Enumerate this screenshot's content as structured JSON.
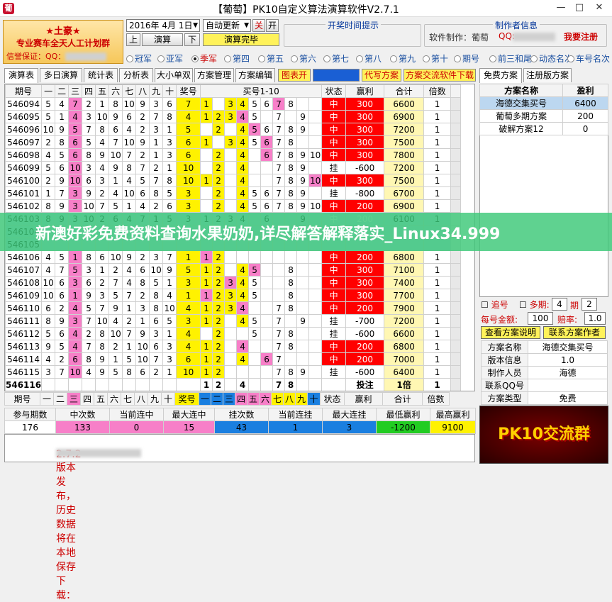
{
  "window": {
    "title": "【葡萄】PK10自定义算法演算软件V2.7.1",
    "icon": "葡"
  },
  "promo": {
    "line1": "★土豪★",
    "line2": "专业赛车全天人工计划群",
    "line3": "信誉保证：QQ："
  },
  "toolbar": {
    "date": "2016年 4月 1日",
    "auto_update": "自动更新",
    "off": "关",
    "on": "开",
    "up": "上",
    "calc": "演算",
    "down": "下",
    "calc_done": "演算完毕",
    "open_time_hint": "开奖时间提示",
    "author_info": "制作者信息",
    "software_by": "软件制作：葡萄",
    "qq_label": "QQ:",
    "register": "我要注册"
  },
  "radios": [
    {
      "label": "冠军",
      "on": false
    },
    {
      "label": "亚军",
      "on": false
    },
    {
      "label": "季军",
      "on": true
    },
    {
      "label": "第四",
      "on": false
    },
    {
      "label": "第五",
      "on": false
    },
    {
      "label": "第六",
      "on": false
    },
    {
      "label": "第七",
      "on": false
    },
    {
      "label": "第八",
      "on": false
    },
    {
      "label": "第九",
      "on": false
    },
    {
      "label": "第十",
      "on": false
    },
    {
      "label": "期号",
      "on": false
    },
    {
      "label": "前三和尾",
      "on": false
    },
    {
      "label": "动态名次",
      "on": false
    },
    {
      "label": "车号名次",
      "on": false
    }
  ],
  "tabs": [
    "演算表",
    "多日演算",
    "统计表",
    "分析表",
    "大小单双",
    "方案管理",
    "方案编辑"
  ],
  "toolbar2": {
    "chart": "图表开",
    "proxy": "代写方案",
    "download": "方案交流软件下载"
  },
  "right_tabs": [
    "免费方案",
    "注册版方案"
  ],
  "grid": {
    "headers": [
      "期号",
      "一",
      "二",
      "三",
      "四",
      "五",
      "六",
      "七",
      "八",
      "九",
      "十",
      "奖号",
      "买号1-10",
      "状态",
      "赢利",
      "合计",
      "倍数"
    ],
    "rows": [
      {
        "p": "546094",
        "n": [
          "5",
          "4",
          "7",
          "2",
          "1",
          "8",
          "10",
          "9",
          "3",
          "6"
        ],
        "j": "7",
        "b": [
          "1",
          "",
          "3",
          "4",
          "5",
          "6",
          "7",
          "8",
          "",
          ""
        ],
        "s": "中",
        "w": "300",
        "t": "6600",
        "m": "1"
      },
      {
        "p": "546095",
        "n": [
          "5",
          "1",
          "4",
          "3",
          "10",
          "9",
          "6",
          "2",
          "7",
          "8"
        ],
        "j": "4",
        "b": [
          "1",
          "2",
          "3",
          "4",
          "5",
          "",
          "7",
          "",
          "9",
          ""
        ],
        "s": "中",
        "w": "300",
        "t": "6900",
        "m": "1"
      },
      {
        "p": "546096",
        "n": [
          "10",
          "9",
          "5",
          "7",
          "8",
          "6",
          "4",
          "2",
          "3",
          "1"
        ],
        "j": "5",
        "b": [
          "",
          "2",
          "",
          "4",
          "5",
          "6",
          "7",
          "8",
          "9",
          ""
        ],
        "s": "中",
        "w": "300",
        "t": "7200",
        "m": "1"
      },
      {
        "p": "546097",
        "n": [
          "2",
          "8",
          "6",
          "5",
          "4",
          "7",
          "10",
          "9",
          "1",
          "3"
        ],
        "j": "6",
        "b": [
          "1",
          "",
          "3",
          "4",
          "5",
          "6",
          "7",
          "8",
          "",
          ""
        ],
        "s": "中",
        "w": "300",
        "t": "7500",
        "m": "1"
      },
      {
        "p": "546098",
        "n": [
          "4",
          "5",
          "6",
          "8",
          "9",
          "10",
          "7",
          "2",
          "1",
          "3"
        ],
        "j": "6",
        "b": [
          "",
          "2",
          "",
          "4",
          "",
          "6",
          "7",
          "8",
          "9",
          "10"
        ],
        "s": "中",
        "w": "300",
        "t": "7800",
        "m": "1"
      },
      {
        "p": "546099",
        "n": [
          "5",
          "6",
          "10",
          "3",
          "4",
          "9",
          "8",
          "7",
          "2",
          "1"
        ],
        "j": "10",
        "b": [
          "",
          "2",
          "",
          "4",
          "",
          "",
          "7",
          "8",
          "9",
          ""
        ],
        "s": "挂",
        "w": "-600",
        "t": "7200",
        "m": "1"
      },
      {
        "p": "546100",
        "n": [
          "2",
          "9",
          "10",
          "6",
          "3",
          "1",
          "4",
          "5",
          "7",
          "8"
        ],
        "j": "10",
        "b": [
          "1",
          "2",
          "",
          "4",
          "",
          "",
          "7",
          "8",
          "9",
          "10"
        ],
        "s": "中",
        "w": "300",
        "t": "7500",
        "m": "1"
      },
      {
        "p": "546101",
        "n": [
          "1",
          "7",
          "3",
          "9",
          "2",
          "4",
          "10",
          "6",
          "8",
          "5"
        ],
        "j": "3",
        "b": [
          "",
          "2",
          "",
          "4",
          "5",
          "6",
          "7",
          "8",
          "9",
          ""
        ],
        "s": "挂",
        "w": "-800",
        "t": "6700",
        "m": "1"
      },
      {
        "p": "546102",
        "n": [
          "8",
          "9",
          "3",
          "10",
          "7",
          "5",
          "1",
          "4",
          "2",
          "6"
        ],
        "j": "3",
        "b": [
          "",
          "2",
          "",
          "4",
          "5",
          "6",
          "7",
          "8",
          "9",
          "10"
        ],
        "s": "中",
        "w": "200",
        "t": "6900",
        "m": "1"
      },
      {
        "p": "546103",
        "n": [
          "8",
          "9",
          "3",
          "10",
          "2",
          "6",
          "4",
          "7",
          "1",
          "5"
        ],
        "j": "3",
        "b": [
          "1",
          "2",
          "3",
          "4",
          "",
          "6",
          "",
          "",
          "9",
          ""
        ],
        "s": "中",
        "w": "200",
        "t": "6100",
        "m": "1"
      },
      {
        "p": "546104",
        "n": [
          "",
          "",
          "",
          "",
          "",
          "",
          "",
          "",
          "",
          ""
        ],
        "j": "",
        "b": [
          "",
          "",
          "",
          "",
          "",
          "",
          "",
          "",
          "",
          ""
        ],
        "s": "",
        "w": "",
        "t": "",
        "m": ""
      },
      {
        "p": "546105",
        "n": [
          "",
          "",
          "",
          "",
          "",
          "",
          "",
          "",
          "",
          ""
        ],
        "j": "",
        "b": [
          "",
          "",
          "",
          "",
          "",
          "",
          "",
          "",
          "",
          ""
        ],
        "s": "",
        "w": "",
        "t": "",
        "m": ""
      },
      {
        "p": "546106",
        "n": [
          "4",
          "5",
          "1",
          "8",
          "6",
          "10",
          "9",
          "2",
          "3",
          "7"
        ],
        "j": "1",
        "b": [
          "1",
          "2",
          "",
          "",
          "",
          "",
          "",
          "",
          "",
          ""
        ],
        "s": "中",
        "w": "200",
        "t": "6800",
        "m": "1"
      },
      {
        "p": "546107",
        "n": [
          "4",
          "7",
          "5",
          "3",
          "1",
          "2",
          "4",
          "6",
          "10",
          "9"
        ],
        "j": "5",
        "b": [
          "1",
          "2",
          "",
          "4",
          "5",
          "",
          "",
          "8",
          "",
          ""
        ],
        "s": "中",
        "w": "300",
        "t": "7100",
        "m": "1"
      },
      {
        "p": "546108",
        "n": [
          "10",
          "6",
          "3",
          "6",
          "2",
          "7",
          "4",
          "8",
          "5",
          "1"
        ],
        "j": "3",
        "b": [
          "1",
          "2",
          "3",
          "4",
          "5",
          "",
          "",
          "8",
          "",
          ""
        ],
        "s": "中",
        "w": "300",
        "t": "7400",
        "m": "1"
      },
      {
        "p": "546109",
        "n": [
          "10",
          "6",
          "1",
          "9",
          "3",
          "5",
          "7",
          "2",
          "8",
          "4"
        ],
        "j": "1",
        "b": [
          "1",
          "2",
          "3",
          "4",
          "5",
          "",
          "",
          "8",
          "",
          ""
        ],
        "s": "中",
        "w": "300",
        "t": "7700",
        "m": "1"
      },
      {
        "p": "546110",
        "n": [
          "6",
          "2",
          "4",
          "5",
          "7",
          "9",
          "1",
          "3",
          "8",
          "10"
        ],
        "j": "4",
        "b": [
          "1",
          "2",
          "3",
          "4",
          "",
          "",
          "7",
          "8",
          "",
          ""
        ],
        "s": "中",
        "w": "200",
        "t": "7900",
        "m": "1"
      },
      {
        "p": "546111",
        "n": [
          "8",
          "9",
          "3",
          "7",
          "10",
          "4",
          "2",
          "1",
          "6",
          "5"
        ],
        "j": "3",
        "b": [
          "1",
          "2",
          "",
          "4",
          "5",
          "",
          "7",
          "",
          "9",
          ""
        ],
        "s": "挂",
        "w": "-700",
        "t": "7200",
        "m": "1"
      },
      {
        "p": "546112",
        "n": [
          "5",
          "6",
          "4",
          "2",
          "8",
          "10",
          "7",
          "9",
          "3",
          "1"
        ],
        "j": "4",
        "b": [
          "",
          "2",
          "",
          "",
          "5",
          "",
          "7",
          "8",
          "",
          ""
        ],
        "s": "挂",
        "w": "-600",
        "t": "6600",
        "m": "1"
      },
      {
        "p": "546113",
        "n": [
          "9",
          "5",
          "4",
          "7",
          "8",
          "2",
          "1",
          "10",
          "6",
          "3"
        ],
        "j": "4",
        "b": [
          "1",
          "2",
          "",
          "4",
          "",
          "",
          "7",
          "8",
          "",
          ""
        ],
        "s": "中",
        "w": "200",
        "t": "6800",
        "m": "1"
      },
      {
        "p": "546114",
        "n": [
          "4",
          "2",
          "6",
          "8",
          "9",
          "1",
          "5",
          "10",
          "7",
          "3"
        ],
        "j": "6",
        "b": [
          "1",
          "2",
          "",
          "4",
          "",
          "6",
          "7",
          "",
          "",
          ""
        ],
        "s": "中",
        "w": "200",
        "t": "7000",
        "m": "1"
      },
      {
        "p": "546115",
        "n": [
          "3",
          "7",
          "10",
          "4",
          "9",
          "5",
          "8",
          "6",
          "2",
          "1"
        ],
        "j": "10",
        "b": [
          "1",
          "2",
          "",
          "",
          "",
          "",
          "7",
          "8",
          "9",
          ""
        ],
        "s": "挂",
        "w": "-600",
        "t": "6400",
        "m": "1"
      }
    ],
    "current": {
      "p": "546116",
      "b": [
        "1",
        "2",
        "",
        "4",
        "",
        "",
        "7",
        "8",
        "",
        ""
      ],
      "s": "投注",
      "t": "1倍",
      "m": "1"
    }
  },
  "footer_head": {
    "p": "期号",
    "nums": [
      "一",
      "二",
      "三",
      "四",
      "五",
      "六",
      "七",
      "八",
      "九",
      "十"
    ],
    "j": "奖号",
    "b": [
      "一",
      "二",
      "三",
      "四",
      "五",
      "六",
      "七",
      "八",
      "九",
      "十"
    ],
    "s": "状态",
    "w": "赢利",
    "t": "合计",
    "m": "倍数"
  },
  "stats": {
    "labels": [
      "参与期数",
      "中次数",
      "当前连中",
      "最大连中",
      "挂次数",
      "当前连挂",
      "最大连挂",
      "最低赢利",
      "最高赢利"
    ],
    "values": [
      "176",
      "133",
      "0",
      "15",
      "43",
      "1",
      "3",
      "-1200",
      "9100"
    ]
  },
  "notice": "2.7.2 版本发布，历史数据将在本地保存 下载：",
  "right": {
    "plan_headers": [
      "方案名称",
      "盈利"
    ],
    "plans": [
      {
        "name": "海德交集买号",
        "profit": "6400"
      },
      {
        "name": "葡萄多期方案",
        "profit": "200"
      },
      {
        "name": "破解方案12",
        "profit": "0"
      }
    ],
    "chase": "追号",
    "multi": "多期:",
    "multi_val": "4",
    "period": "期",
    "period_val": "2",
    "bet_label": "每号金额:",
    "bet_val": "100",
    "odds_label": "赔率:",
    "odds_val": "1.0",
    "help": "查看方案说明",
    "contact": "联系方案作者",
    "info": [
      [
        "方案名称",
        "海德交集买号"
      ],
      [
        "版本信息",
        "1.0"
      ],
      [
        "制作人员",
        "海德"
      ],
      [
        "联系QQ号",
        ""
      ],
      [
        "方案类型",
        "免费"
      ]
    ]
  },
  "logo": "PK10交流群",
  "banner": "新澳好彩免费资料查询水果奶奶,详尽解答解释落实_Linux34.999",
  "colors": {
    "pink": "#f77fc8",
    "yellow": "#fff200",
    "red": "#ff0000",
    "banner": "#3cc878"
  }
}
